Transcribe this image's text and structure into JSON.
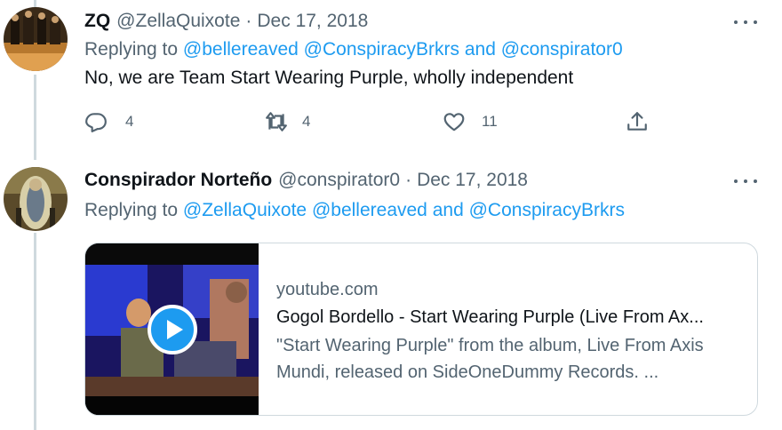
{
  "tweets": [
    {
      "name": "ZQ",
      "handle": "@ZellaQuixote",
      "separator": "·",
      "date": "Dec 17, 2018",
      "replying_prefix": "Replying to",
      "mentions": [
        "@bellereaved",
        "@ConspiracyBrkrs",
        "and",
        "@conspirator0"
      ],
      "text": "No, we are Team Start Wearing Purple, wholly independent",
      "actions": {
        "reply_count": "4",
        "retweet_count": "4",
        "like_count": "11"
      }
    },
    {
      "name": "Conspirador Norteño",
      "handle": "@conspirator0",
      "separator": "·",
      "date": "Dec 17, 2018",
      "replying_prefix": "Replying to",
      "mentions": [
        "@ZellaQuixote",
        "@bellereaved",
        "and",
        "@ConspiracyBrkrs"
      ],
      "card": {
        "domain": "youtube.com",
        "title": "Gogol Bordello - Start Wearing Purple (Live From Ax...",
        "description": "\"Start Wearing Purple\" from the album, Live From Axis Mundi, released on SideOneDummy Records. ..."
      }
    }
  ],
  "colors": {
    "accent": "#1d9bf0",
    "secondary_text": "#536471",
    "primary_text": "#0f1419",
    "border": "#cfd9de"
  },
  "icons": [
    "reply-icon",
    "retweet-icon",
    "like-icon",
    "share-icon",
    "more-icon",
    "play-icon"
  ]
}
